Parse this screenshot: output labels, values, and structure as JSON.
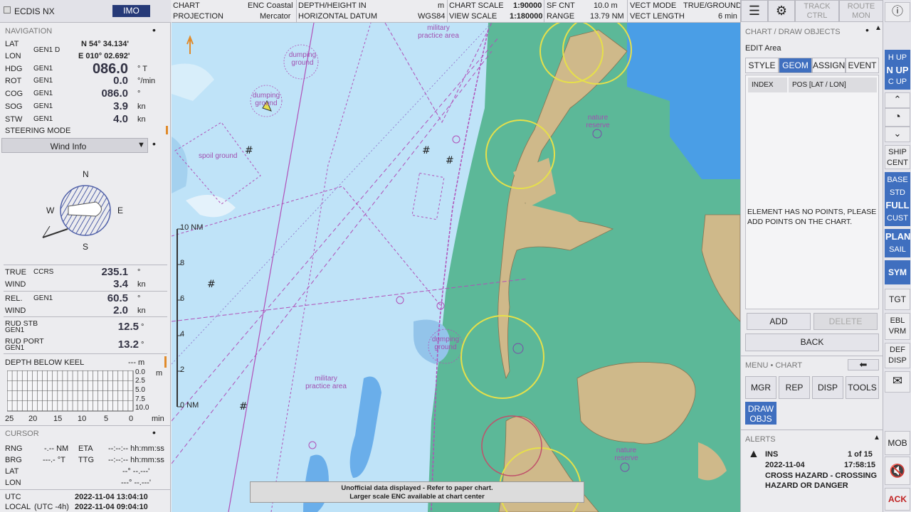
{
  "app": {
    "title": "ECDIS NX",
    "imo_label": "IMO"
  },
  "navigation": {
    "title": "NAVIGATION",
    "lat": {
      "label": "LAT",
      "src": "GEN1 D",
      "value": "N 54° 34.134'"
    },
    "lon": {
      "label": "LON",
      "value": "E 010° 02.692'"
    },
    "hdg": {
      "label": "HDG",
      "src": "GEN1",
      "value": "086.0",
      "unit": "° T"
    },
    "rot": {
      "label": "ROT",
      "src": "GEN1",
      "value": "0.0",
      "unit": "°/min"
    },
    "cog": {
      "label": "COG",
      "src": "GEN1",
      "value": "086.0",
      "unit": "°"
    },
    "sog": {
      "label": "SOG",
      "src": "GEN1",
      "value": "3.9",
      "unit": "kn"
    },
    "stw": {
      "label": "STW",
      "src": "GEN1",
      "value": "4.0",
      "unit": "kn"
    },
    "steering_mode": "STEERING MODE"
  },
  "wind": {
    "dropdown": "Wind Info",
    "compass": {
      "n": "N",
      "s": "S",
      "e": "E",
      "w": "W"
    },
    "true_label": "TRUE",
    "true_src": "CCRS",
    "true_dir": "235.1",
    "true_dir_unit": "°",
    "true_wind_label": "WIND",
    "true_speed": "3.4",
    "true_speed_unit": "kn",
    "rel_label": "REL.",
    "rel_src": "GEN1",
    "rel_dir": "60.5",
    "rel_dir_unit": "°",
    "rel_wind_label": "WIND",
    "rel_speed": "2.0",
    "rel_speed_unit": "kn"
  },
  "rudder": {
    "stb_label": "RUD STB",
    "stb_src": "GEN1",
    "stb_value": "12.5",
    "stb_unit": "°",
    "port_label": "RUD PORT",
    "port_src": "GEN1",
    "port_value": "13.2",
    "port_unit": "°"
  },
  "depth": {
    "title": "DEPTH BELOW KEEL",
    "value": "--- m",
    "y_ticks": [
      "0.0",
      "2.5",
      "5.0",
      "7.5",
      "10.0"
    ],
    "y_unit": "m",
    "x_ticks": [
      "25",
      "20",
      "15",
      "10",
      "5",
      "0"
    ],
    "x_unit": "min"
  },
  "cursor": {
    "title": "CURSOR",
    "rng_label": "RNG",
    "rng_value": "-.-- NM",
    "eta_label": "ETA",
    "eta_value": "--:--:-- hh:mm:ss",
    "brg_label": "BRG",
    "brg_value": "---.- °T",
    "ttg_label": "TTG",
    "ttg_value": "--:--:-- hh:mm:ss",
    "lat_label": "LAT",
    "lat_value": "--° --.---'",
    "lon_label": "LON",
    "lon_value": "---° --.---'"
  },
  "time": {
    "utc_label": "UTC",
    "utc_value": "2022-11-04   13:04:10",
    "local_label": "LOCAL",
    "local_tz": "(UTC -4h)",
    "local_value": "2022-11-04   09:04:10"
  },
  "topbar": {
    "chart_label": "CHART",
    "chart_value": "ENC  Coastal",
    "projection_label": "PROJECTION",
    "projection_value": "Mercator",
    "depth_label": "DEPTH/HEIGHT IN",
    "depth_value": "m",
    "datum_label": "HORIZONTAL DATUM",
    "datum_value": "WGS84",
    "scale_label": "CHART SCALE",
    "scale_value": "1:90000",
    "view_label": "VIEW SCALE",
    "view_value": "1:180000",
    "sfcnt_label": "SF CNT",
    "sfcnt_value": "10.0 m",
    "range_label": "RANGE",
    "range_value": "13.79 NM",
    "vectmode_label": "VECT MODE",
    "vectmode_value": "TRUE/GROUND",
    "vectlen_label": "VECT LENGTH",
    "vectlen_value": "6 min"
  },
  "chart_labels": {
    "dumping1": "dumping ground",
    "dumping2": "dumping ground",
    "dumping3": "dumping ground",
    "spoil": "spoil ground",
    "military1": "military practice area",
    "military2": "military practice area",
    "nature1": "nature reserve",
    "nature2": "nature reserve",
    "scale_10": "10 NM",
    "scale_8": "8",
    "scale_6": "6",
    "scale_4": "4",
    "scale_2": "2",
    "scale_0": "0 NM",
    "notice_line1": "Unofficial data displayed - Refer to paper chart.",
    "notice_line2": "Larger scale ENC available at chart center"
  },
  "header_buttons": {
    "track": "TRACK CTRL",
    "route": "ROUTE MON"
  },
  "draw_panel": {
    "title": "CHART / DRAW OBJECTS",
    "subtitle": "EDIT Area",
    "tabs": [
      "STYLE",
      "GEOM",
      "ASSIGN",
      "EVENT"
    ],
    "active_tab": "GEOM",
    "col_index": "INDEX",
    "col_pos": "POS [LAT / LON]",
    "message": "ELEMENT HAS NO POINTS, PLEASE ADD POINTS ON THE CHART.",
    "add": "ADD",
    "delete": "DELETE",
    "back": "BACK"
  },
  "menu": {
    "title": "MENU • CHART",
    "buttons": [
      "MGR",
      "REP",
      "DISP",
      "TOOLS"
    ],
    "draw_objs": "DRAW OBJS"
  },
  "alerts": {
    "title": "ALERTS",
    "source": "INS",
    "count": "1 of 15",
    "date": "2022-11-04",
    "time": "17:58:15",
    "line1": "CROSS HAZARD - CROSSING",
    "line2": "HAZARD OR DANGER"
  },
  "side_buttons": {
    "hup": "H UP",
    "nup": "N UP",
    "cup": "C UP",
    "ship": "SHIP",
    "cent": "CENT",
    "base": "BASE",
    "std": "STD",
    "full": "FULL",
    "cust": "CUST",
    "plan": "PLAN",
    "sail": "SAIL",
    "sym": "SYM",
    "tgt": "TGT",
    "ebl": "EBL",
    "vrm": "VRM",
    "def": "DEF",
    "disp": "DISP",
    "mob": "MOB",
    "ack": "ACK"
  },
  "colors": {
    "land": "#cfb98a",
    "green": "#5cb898",
    "deep": "#bfe3f8",
    "shallow": "#93c4ea",
    "active": "#3f6fbf",
    "magenta": "#b050b8"
  }
}
